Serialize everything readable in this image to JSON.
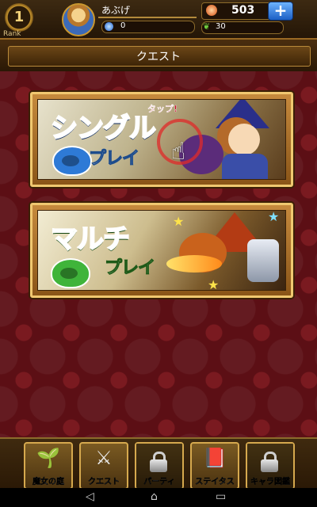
{
  "status": {
    "rank": "1",
    "rank_label": "Rank",
    "player_name": "あぶげ",
    "exp": "0",
    "gems": "503",
    "stamina": "30",
    "add_button": "+"
  },
  "header": {
    "title": "クエスト"
  },
  "quests": {
    "single": {
      "title": "シングル",
      "subtitle": "プレイ",
      "hint": "タップ!"
    },
    "multi": {
      "title": "マルチ",
      "subtitle": "プレイ"
    }
  },
  "nav": [
    {
      "label": "魔女の庭",
      "icon": "sprout-icon",
      "locked": false
    },
    {
      "label": "クエスト",
      "icon": "crossed-swords-icon",
      "locked": false
    },
    {
      "label": "パーティ",
      "icon": "lock-icon",
      "locked": true
    },
    {
      "label": "ステイタス",
      "icon": "book-icon",
      "locked": false
    },
    {
      "label": "キャラ図鑑",
      "icon": "lock-icon",
      "locked": true
    }
  ],
  "system_nav": {
    "back": "◁",
    "home": "⌂",
    "recents": "▭"
  },
  "colors": {
    "accent_gold": "#d6a94e",
    "background": "#5c0f15",
    "single_blue": "#2e7ad6",
    "multi_green": "#3fb43a"
  }
}
